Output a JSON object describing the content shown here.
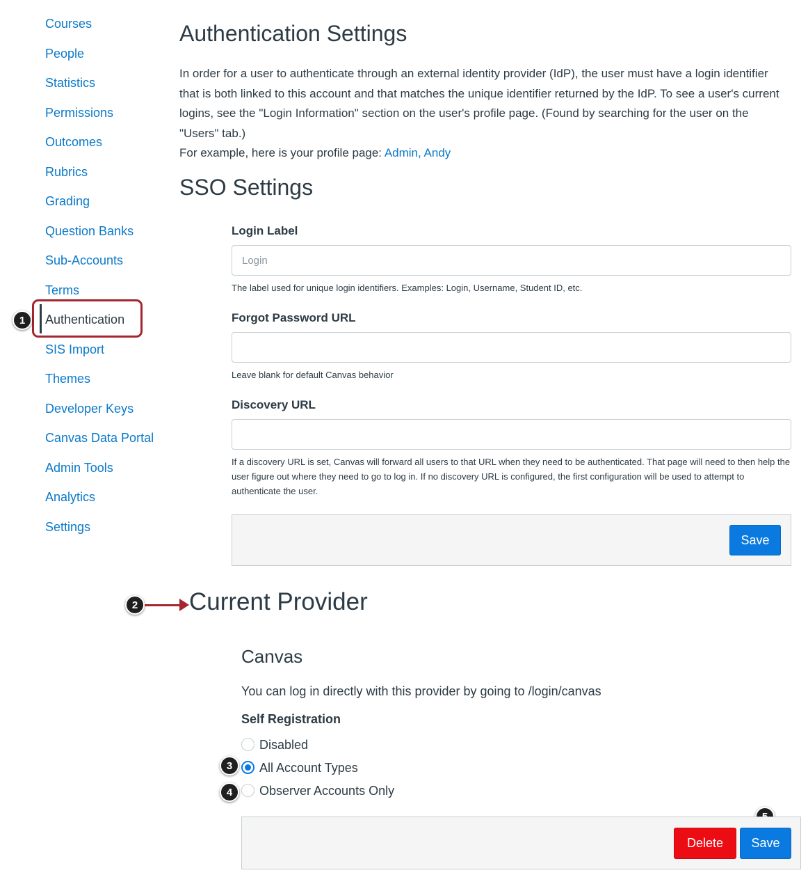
{
  "sidebar": {
    "items": [
      {
        "label": "Courses"
      },
      {
        "label": "People"
      },
      {
        "label": "Statistics"
      },
      {
        "label": "Permissions"
      },
      {
        "label": "Outcomes"
      },
      {
        "label": "Rubrics"
      },
      {
        "label": "Grading"
      },
      {
        "label": "Question Banks"
      },
      {
        "label": "Sub-Accounts"
      },
      {
        "label": "Terms"
      },
      {
        "label": "Authentication",
        "active": true
      },
      {
        "label": "SIS Import"
      },
      {
        "label": "Themes"
      },
      {
        "label": "Developer Keys"
      },
      {
        "label": "Canvas Data Portal"
      },
      {
        "label": "Admin Tools"
      },
      {
        "label": "Analytics"
      },
      {
        "label": "Settings"
      }
    ]
  },
  "callouts": [
    "1",
    "2",
    "3",
    "4",
    "5"
  ],
  "page": {
    "title": "Authentication Settings",
    "intro_text": "In order for a user to authenticate through an external identity provider (IdP), the user must have a login identifier that is both linked to this account and that matches the unique identifier returned by the IdP. To see a user's current logins, see the \"Login Information\" section on the user's profile page. (Found by searching for the user on the \"Users\" tab.)",
    "example_text": "For example, here is your profile page: ",
    "profile_link": "Admin, Andy"
  },
  "sso": {
    "title": "SSO Settings",
    "login_label": {
      "label": "Login Label",
      "value": "",
      "placeholder": "Login",
      "help": "The label used for unique login identifiers. Examples: Login, Username, Student ID, etc."
    },
    "forgot_password": {
      "label": "Forgot Password URL",
      "value": "",
      "help": "Leave blank for default Canvas behavior"
    },
    "discovery": {
      "label": "Discovery URL",
      "value": "",
      "help": "If a discovery URL is set, Canvas will forward all users to that URL when they need to be authenticated. That page will need to then help the user figure out where they need to go to log in. If no discovery URL is configured, the first configuration will be used to attempt to authenticate the user."
    },
    "save_label": "Save"
  },
  "provider": {
    "section_title": "Current Provider",
    "name": "Canvas",
    "description": "You can log in directly with this provider by going to /login/canvas",
    "self_registration_label": "Self Registration",
    "options": [
      {
        "label": "Disabled",
        "checked": false
      },
      {
        "label": "All Account Types",
        "checked": true
      },
      {
        "label": "Observer Accounts Only",
        "checked": false
      }
    ],
    "delete_label": "Delete",
    "save_label": "Save"
  },
  "colors": {
    "link": "#0a79c9",
    "text": "#2d3b45",
    "primary_button": "#0a7ae0",
    "danger_button": "#ec0c13",
    "highlight": "#a5262e"
  }
}
